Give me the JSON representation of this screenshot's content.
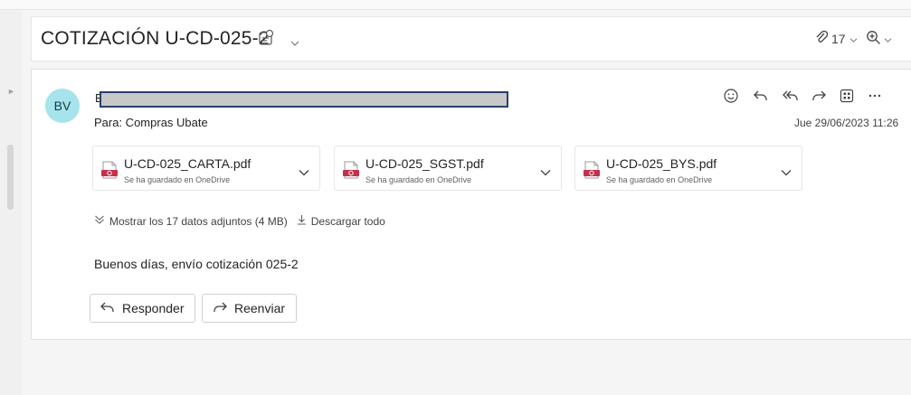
{
  "email": {
    "subject": "COTIZACIÓN U-CD-025-2",
    "attachments_count": "17",
    "sender_initials": "BV",
    "sender_letter": "B",
    "to_line": "Para:  Compras Ubate",
    "date": "Jue 29/06/2023 11:26",
    "attachments": [
      {
        "name": "U-CD-025_CARTA.pdf",
        "status": "Se ha guardado en OneDrive"
      },
      {
        "name": "U-CD-025_SGST.pdf",
        "status": "Se ha guardado en OneDrive"
      },
      {
        "name": "U-CD-025_BYS.pdf",
        "status": "Se ha guardado en OneDrive"
      }
    ],
    "show_all_label": "Mostrar los 17 datos adjuntos (4 MB)",
    "download_all_label": "Descargar todo",
    "body": "Buenos días, envío cotización 025-2",
    "reply_label": "Responder",
    "forward_label": "Reenviar"
  },
  "icons": [
    "summary-icon",
    "chevron-down-icon",
    "paperclip-icon",
    "zoom-icon",
    "emoji-icon",
    "reply-icon",
    "reply-all-icon",
    "forward-icon",
    "apps-icon",
    "more-icon",
    "pdf-icon",
    "expand-icon",
    "download-icon"
  ],
  "colors": {
    "avatar_bg": "#a6e3ea",
    "pdf_red": "#c4314b",
    "redaction_border": "#2d3e6c"
  }
}
